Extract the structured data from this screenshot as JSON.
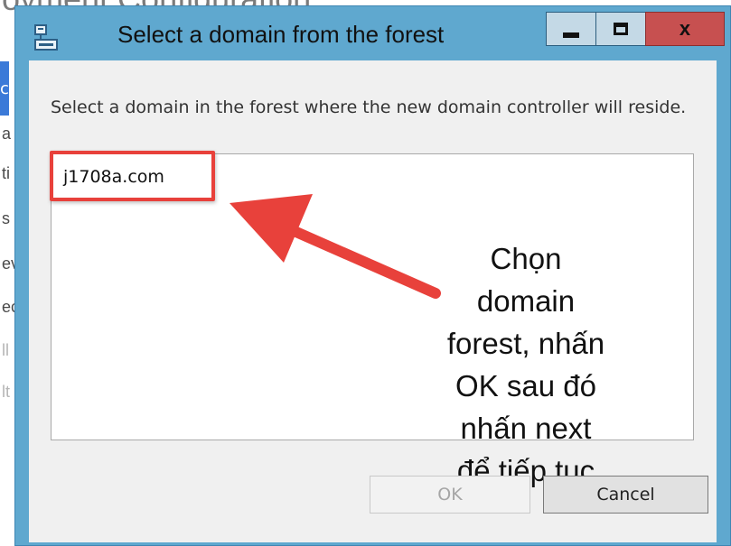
{
  "background_window": {
    "title_fragment": "oyment Configuration",
    "sidebar_fragments": [
      "c",
      "a",
      "ti",
      "s",
      "ev",
      "ec",
      "ll",
      "lt"
    ]
  },
  "dialog": {
    "title": "Select a domain from the forest",
    "title_icon": "domain-icon",
    "close_label": "x",
    "instruction": "Select a domain in the forest where the new domain controller will reside.",
    "domains": [
      "j1708a.com"
    ],
    "ok_label": "OK",
    "cancel_label": "Cancel"
  },
  "annotation": {
    "lines": [
      "Chọn",
      "domain",
      "forest, nhấn",
      "OK sau đó",
      "nhấn next",
      "để tiếp tục"
    ],
    "highlight_color": "#e8413b",
    "arrow_color": "#e8413b"
  },
  "colors": {
    "frame": "#5fa8cf",
    "close_button": "#c75050",
    "client_bg": "#f0f0f0"
  }
}
